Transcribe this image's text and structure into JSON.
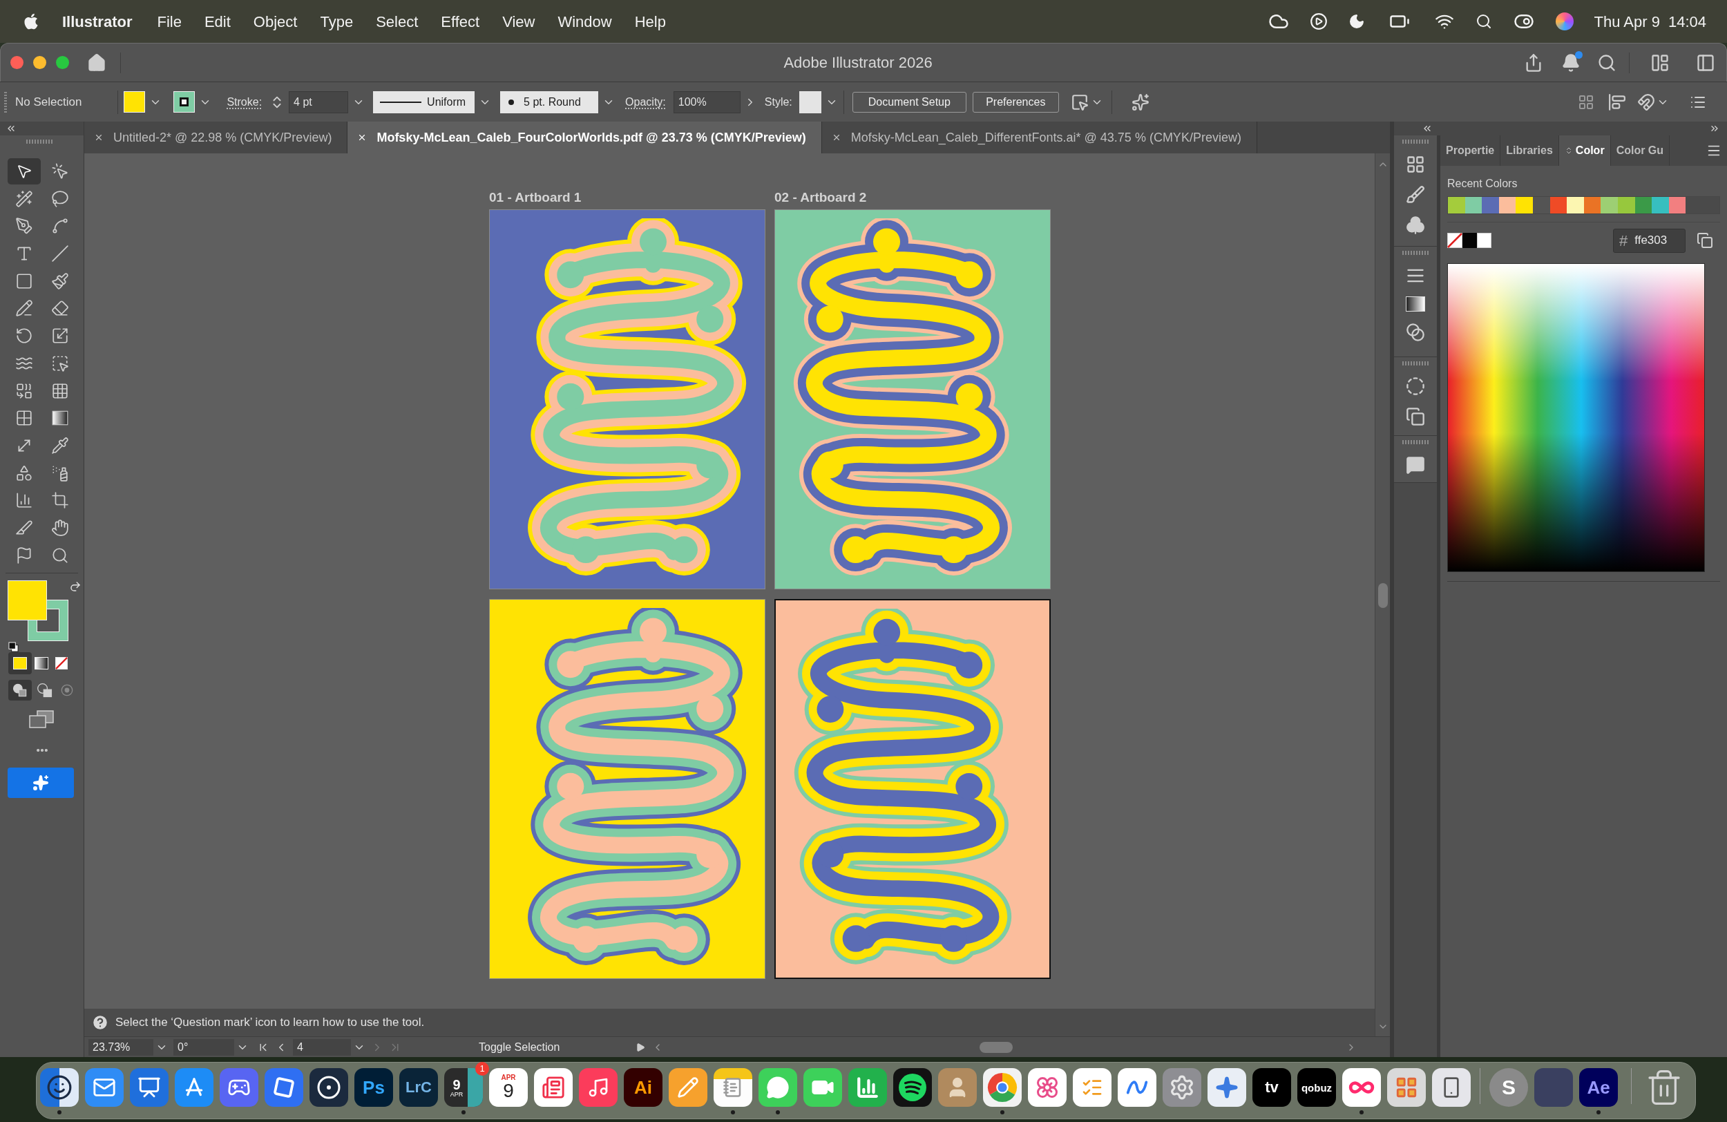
{
  "menu_bar": {
    "app_name": "Illustrator",
    "menus": [
      "File",
      "Edit",
      "Object",
      "Type",
      "Select",
      "Effect",
      "View",
      "Window",
      "Help"
    ],
    "date": "Thu Apr 9",
    "time": "14:04"
  },
  "window": {
    "title": "Adobe Illustrator 2026"
  },
  "control_bar": {
    "selection": "No Selection",
    "fill": {
      "color": "#ffe303"
    },
    "stroke": {
      "color": "#7fcca4"
    },
    "stroke_label": "Stroke:",
    "stroke_weight": "4 pt",
    "profile": "Uniform",
    "brush": "5 pt. Round",
    "opacity_label": "Opacity:",
    "opacity": "100%",
    "style_label": "Style:",
    "buttons": [
      "Document Setup",
      "Preferences"
    ]
  },
  "document_tabs": [
    {
      "label": "Untitled-2* @ 22.98 % (CMYK/Preview)",
      "selected": false
    },
    {
      "label": "Mofsky-McLean_Caleb_FourColorWorlds.pdf @ 23.73 % (CMYK/Preview)",
      "selected": true
    },
    {
      "label": "Mofsky-McLean_Caleb_DifferentFonts.ai* @ 43.75 % (CMYK/Preview)",
      "selected": false
    }
  ],
  "toolbar": {
    "tools": [
      {
        "selected": true
      },
      {
        "selected": false
      },
      {
        "selected": false
      },
      {
        "selected": false
      },
      {
        "selected": false
      },
      {
        "selected": false
      },
      {
        "selected": false
      },
      {
        "selected": false
      },
      {
        "selected": false
      },
      {
        "selected": false
      },
      {
        "selected": false
      },
      {
        "selected": false
      },
      {
        "selected": false
      },
      {
        "selected": false
      },
      {
        "selected": false
      },
      {
        "selected": false
      },
      {
        "selected": false
      },
      {
        "selected": false
      },
      {
        "selected": false
      },
      {
        "selected": false
      },
      {
        "selected": false
      },
      {
        "selected": false
      },
      {
        "selected": false
      },
      {
        "selected": false
      },
      {
        "selected": false
      },
      {
        "selected": false
      },
      {
        "selected": false
      },
      {
        "selected": false
      },
      {
        "selected": false
      },
      {
        "selected": false
      }
    ],
    "fill": {
      "color": "#ffe303"
    },
    "stroke": {
      "color": "#7fcca4"
    },
    "paint_modes": [
      {
        "selected": true
      },
      {
        "selected": false
      },
      {
        "selected": false
      }
    ],
    "draw_modes": [
      {
        "selected": true
      },
      {
        "selected": false
      },
      {
        "selected": false
      }
    ]
  },
  "artboards": [
    {
      "label": "01 - Artboard 1",
      "selected": false,
      "color": "#5b6cb4",
      "blob_layers": [
        {
          "color": "#ffe303"
        },
        {
          "color": "#fbbd9c"
        },
        {
          "color": "#7fcca4"
        }
      ]
    },
    {
      "label": "02 - Artboard 2",
      "selected": false,
      "color": "#7fcca4",
      "blob_layers": [
        {
          "color": "#fbbd9c"
        },
        {
          "color": "#5b6cb4"
        },
        {
          "color": "#ffe303"
        }
      ]
    },
    {
      "selected": false,
      "color": "#ffe303",
      "blob_layers": [
        {
          "color": "#5b6cb4"
        },
        {
          "color": "#7fcca4"
        },
        {
          "color": "#fbbd9c"
        }
      ]
    },
    {
      "selected": true,
      "color": "#fbbd9c",
      "blob_layers": [
        {
          "color": "#7fcca4"
        },
        {
          "color": "#ffe303"
        },
        {
          "color": "#5b6cb4"
        }
      ]
    }
  ],
  "panel": {
    "tabs": [
      {
        "label": "Propertie",
        "selected": false
      },
      {
        "label": "Libraries",
        "selected": false
      },
      {
        "label": "Color",
        "selected": true
      },
      {
        "label": "Color Gu",
        "selected": false
      }
    ],
    "recent_colors_label": "Recent Colors",
    "recent_colors": [
      {
        "color": "#a4cc3c"
      },
      {
        "color": "#7fcca4"
      },
      {
        "color": "#5b6cb4"
      },
      {
        "color": "#fbbd9c"
      },
      {
        "color": "#ffe303"
      },
      {
        "color": "#545454"
      },
      {
        "color": "#ef4b26"
      },
      {
        "color": "#fcf6b1"
      },
      {
        "color": "#ea7325"
      },
      {
        "color": "#9dcf73"
      },
      {
        "color": "#97c83d"
      },
      {
        "color": "#3b9a48"
      },
      {
        "color": "#37bfbf"
      },
      {
        "color": "#f27f80"
      }
    ],
    "hex_label": "#",
    "hex_value": "ffe303"
  },
  "status_bar": {
    "hint": "Select the ‘Question mark’ icon to learn how to use the tool.",
    "zoom": "23.73%",
    "rotation": "0°",
    "artboard": "4",
    "tool": "Toggle Selection"
  },
  "dock": {
    "items": [
      {
        "running": true
      },
      {
        "running": false
      },
      {
        "running": false
      },
      {
        "running": false
      },
      {
        "running": false
      },
      {
        "running": false
      },
      {
        "running": false
      },
      {
        "running": false,
        "texts": [
          "Ps"
        ]
      },
      {
        "running": false,
        "texts": [
          "LrC"
        ]
      },
      {
        "running": true,
        "texts": [
          "9",
          "APR"
        ],
        "badge": "1"
      },
      {
        "running": false,
        "texts": [
          "APR",
          "9"
        ]
      },
      {
        "running": false
      },
      {
        "running": false
      },
      {
        "running": false,
        "texts": [
          "Ai"
        ]
      },
      {
        "running": false
      },
      {
        "running": true
      },
      {
        "running": true
      },
      {
        "running": false
      },
      {
        "running": false
      },
      {
        "running": false
      },
      {
        "running": false
      },
      {
        "running": true
      },
      {
        "running": false
      },
      {
        "running": false
      },
      {
        "running": false
      },
      {
        "running": false
      },
      {
        "running": false
      },
      {
        "running": false,
        "texts": [
          "tv"
        ]
      },
      {
        "running": false,
        "texts": [
          "qobuz"
        ]
      },
      {
        "running": true
      },
      {
        "running": false
      },
      {
        "running": false
      },
      {
        "running": false,
        "texts": [
          "S"
        ]
      },
      {
        "running": false
      },
      {
        "running": true,
        "texts": [
          "Ae"
        ]
      },
      {
        "running": false
      }
    ]
  }
}
